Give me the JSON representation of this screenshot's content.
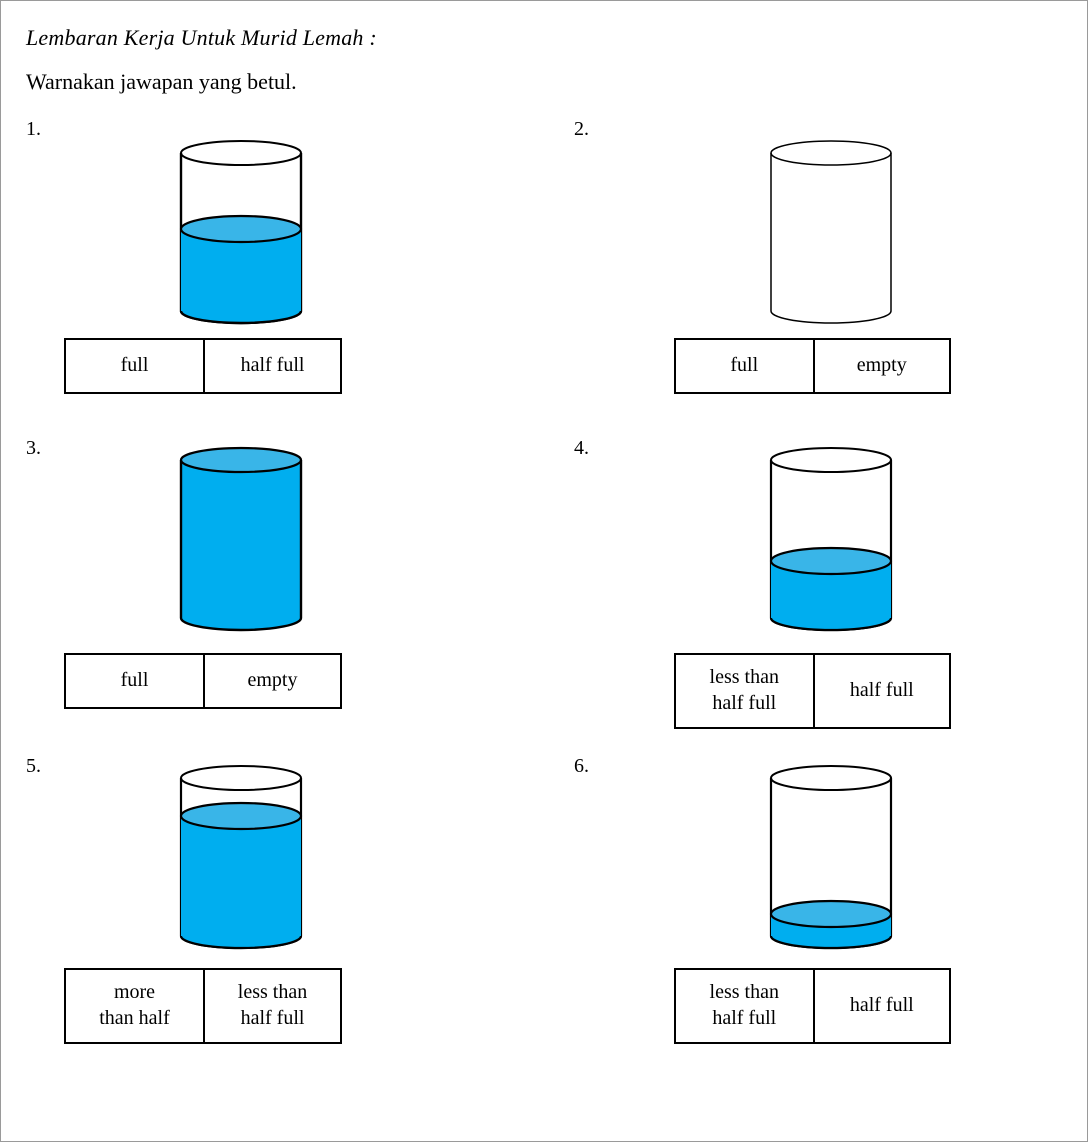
{
  "header": {
    "title": "Lembaran Kerja Untuk Murid Lemah :",
    "instruction": "Warnakan jawapan yang betul."
  },
  "colors": {
    "liquid_body": "#00AEEF",
    "liquid_surface": "#39B5E8",
    "outline": "#000000",
    "page_border": "#9a9a9a",
    "box_border": "#000000",
    "background": "#ffffff"
  },
  "items": [
    {
      "number": "1.",
      "fill_fraction": 0.55,
      "fill_label": "half full",
      "options": [
        "full",
        "half full"
      ],
      "box_two_line": false
    },
    {
      "number": "2.",
      "fill_fraction": 0.0,
      "fill_label": "empty",
      "options": [
        "full",
        "empty"
      ],
      "box_two_line": false
    },
    {
      "number": "3.",
      "fill_fraction": 1.0,
      "fill_label": "full",
      "options": [
        "full",
        "empty"
      ],
      "box_two_line": false
    },
    {
      "number": "4.",
      "fill_fraction": 0.36,
      "fill_label": "less than half full",
      "options": [
        "less than\nhalf full",
        "half full"
      ],
      "box_two_line": true
    },
    {
      "number": "5.",
      "fill_fraction": 0.78,
      "fill_label": "more than half",
      "options": [
        "more\nthan half",
        "less than\nhalf full"
      ],
      "box_two_line": true
    },
    {
      "number": "6.",
      "fill_fraction": 0.13,
      "fill_label": "less than half full",
      "options": [
        "less than\nhalf full",
        "half full"
      ],
      "box_two_line": true
    }
  ]
}
